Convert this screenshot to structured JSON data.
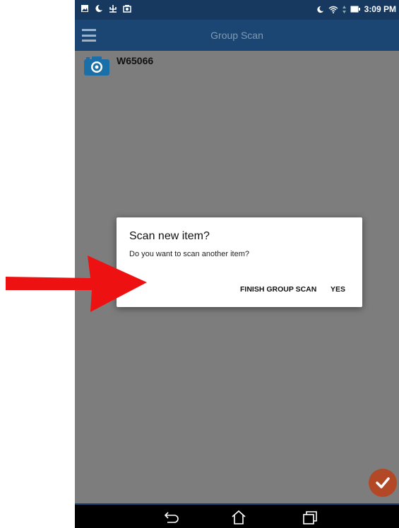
{
  "statusbar": {
    "time": "3:09 PM"
  },
  "appbar": {
    "title": "Group Scan"
  },
  "list": {
    "items": [
      {
        "title": "W65066"
      }
    ]
  },
  "dialog": {
    "title": "Scan new item?",
    "message": "Do you want to scan another item?",
    "buttons": {
      "finish": "FINISH GROUP SCAN",
      "yes": "YES"
    }
  },
  "colors": {
    "appbar": "#1b4674",
    "statusbar": "#17395f",
    "overlay": "#7d7d7d",
    "fab": "#b34826",
    "arrow": "#ee1111"
  },
  "icons": {
    "menu": "menu-icon",
    "camera": "camera-icon",
    "fab": "check-icon",
    "arrow": "red-arrow",
    "nav": [
      "back-icon",
      "home-icon",
      "recent-apps-icon"
    ]
  }
}
